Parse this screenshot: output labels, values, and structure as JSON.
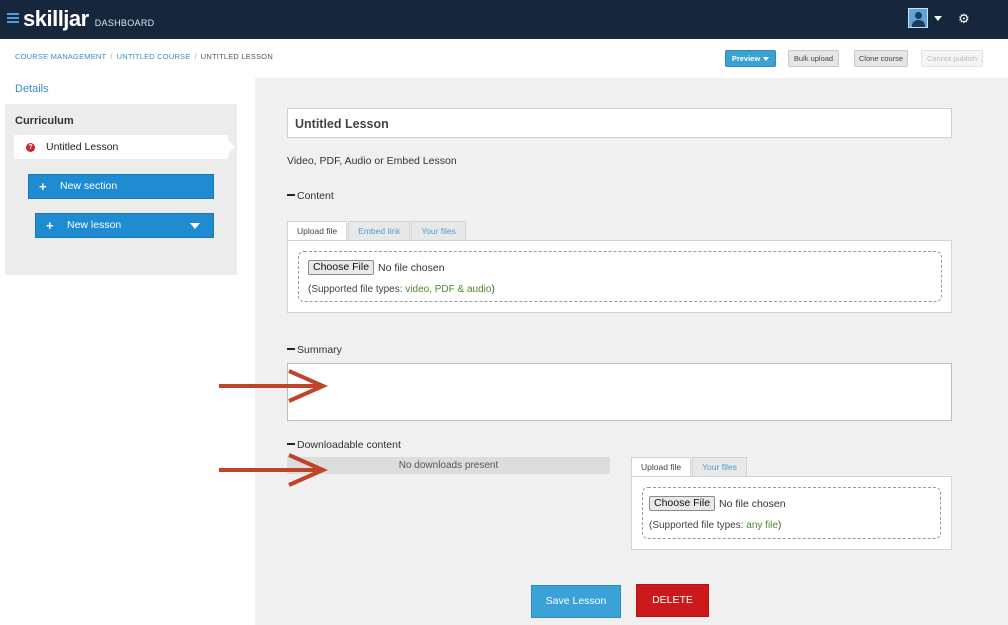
{
  "app": {
    "logo_text": "skilljar",
    "logo_sub": "DASHBOARD"
  },
  "breadcrumb": {
    "items": [
      "COURSE MANAGEMENT",
      "UNTITLED COURSE",
      "UNTITLED LESSON"
    ],
    "separator": "/"
  },
  "toolbar": {
    "preview_label": "Preview",
    "bulk_upload_label": "Bulk upload",
    "clone_course_label": "Clone course",
    "cannot_publish_label": "Cannot publish"
  },
  "sidebar": {
    "details_label": "Details",
    "curriculum_title": "Curriculum",
    "lesson_label": "Untitled Lesson",
    "warning_glyph": "?",
    "new_section_label": "New section",
    "new_lesson_label": "New lesson",
    "plus_glyph": "+"
  },
  "main": {
    "title_value": "Untitled Lesson",
    "lesson_type": "Video, PDF, Audio or Embed Lesson",
    "content": {
      "section_label": "Content",
      "tabs": [
        "Upload file",
        "Embed link",
        "Your files"
      ],
      "choose_file_label": "Choose File",
      "no_file_text": "No file chosen",
      "supported_prefix": "(Supported file types: ",
      "supported_types": "video, PDF & audio",
      "supported_suffix": ")"
    },
    "summary": {
      "section_label": "Summary",
      "value": ""
    },
    "downloadable": {
      "section_label": "Downloadable content",
      "empty_text": "No downloads present",
      "tabs": [
        "Upload file",
        "Your files"
      ],
      "choose_file_label": "Choose File",
      "no_file_text": "No file chosen",
      "supported_prefix": "(Supported file types: ",
      "supported_types": "any file",
      "supported_suffix": ")"
    },
    "save_label": "Save Lesson",
    "delete_label": "DELETE"
  },
  "icons": {
    "settings": "gear-icon",
    "user": "avatar-icon",
    "menu_caret": "chevron-down-icon"
  },
  "colors": {
    "topbar": "#16263d",
    "accent": "#1f8bd0",
    "delete": "#cc1a1a",
    "annotation_arrow": "#c0442a",
    "supported_green": "#4a8a2a"
  }
}
